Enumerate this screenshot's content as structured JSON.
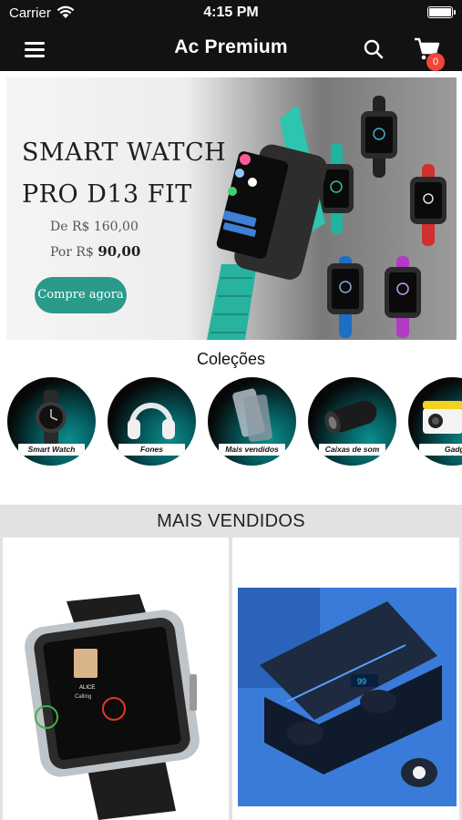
{
  "status_bar": {
    "carrier": "Carrier",
    "time": "4:15 PM"
  },
  "nav": {
    "title": "Ac Premium",
    "cart_count": "0"
  },
  "banner": {
    "headline_line1": "SMART WATCH",
    "headline_line2": "PRO D13 FIT",
    "old_price": "De R$ 160,00",
    "new_price_prefix": "Por R$ ",
    "new_price_value": "90,00",
    "cta": "Compre agora"
  },
  "collections": {
    "title": "Coleções",
    "items": [
      {
        "label": "Smart Watch",
        "icon": "smartwatch-icon"
      },
      {
        "label": "Fones",
        "icon": "headphones-icon"
      },
      {
        "label": "Mais vendidos",
        "icon": "phone-case-icon"
      },
      {
        "label": "Caixas de som",
        "icon": "speaker-icon"
      },
      {
        "label": "Gadget",
        "icon": "projector-icon"
      }
    ]
  },
  "best_sellers": {
    "title": "MAIS VENDIDOS"
  },
  "colors": {
    "bar": "#121212",
    "accent": "#2a9a8a",
    "badge": "#f2453b",
    "section_bg": "#e2e2e2"
  }
}
